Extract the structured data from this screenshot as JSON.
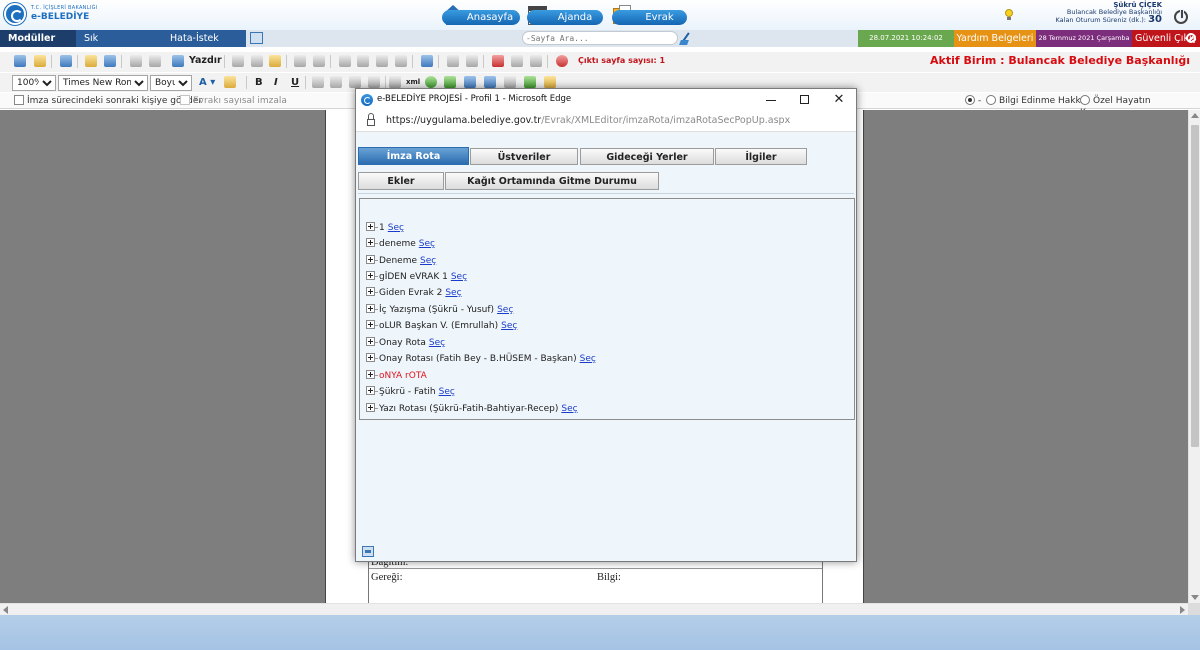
{
  "header": {
    "logo_top": "T.C. İÇİŞLERİ BAKANLIĞI",
    "logo_text": "e-BELEDİYE",
    "nav": [
      {
        "label": "Anasayfa",
        "icon": "home-icon"
      },
      {
        "label": "Ajanda",
        "icon": "calendar-icon",
        "icon_text": "13"
      },
      {
        "label": "Evrak",
        "icon": "documents-icon"
      }
    ],
    "user": {
      "name": "Şükrü ÇİÇEK",
      "unit": "Bulancak Belediye Başkanlığı",
      "timeout_label": "Kalan Oturum Süreniz (dk.):",
      "timeout_value": "30"
    }
  },
  "menubar": {
    "moduller": "Modüller",
    "sik": "Sık Kullanılanlar",
    "hata": "Hata-İstek Bildir",
    "search_placeholder": "-Sayfa Ara...",
    "datetime": "28.07.2021 10:24:02",
    "yardim": "Yardım Belgeleri",
    "today": "28 Temmuz 2021 Çarşamba",
    "exit": "Güvenli Çıkış"
  },
  "toolbar": {
    "print_label": "Yazdır",
    "xml_label": "xml",
    "page_count_label": "Çıktı sayfa sayısı: 1",
    "active_unit": "Aktif Birim : Bulancak Belediye Başkanlığı",
    "zoom": "100%",
    "font": "Times New Roman",
    "size": "Boyut",
    "format_buttons": [
      "A",
      "B",
      "I",
      "U"
    ]
  },
  "checkbar": {
    "sign_next": "İmza sürecindeki sonraki kişiye gönder",
    "sign_digital": "Evrakı sayısal imzala",
    "radio_none": "-",
    "radio_info": "Bilgi Edinme Hakkı",
    "radio_privacy": "Özel Hayatın Korunması"
  },
  "document": {
    "dagitim": "Dağıtım:",
    "geregi": "Gereği:",
    "bilgi": "Bilgi:"
  },
  "popup": {
    "title": "e-BELEDİYE PROJESİ - Profil 1 - Microsoft Edge",
    "url_host": "https://uygulama.belediye.gov.tr",
    "url_path": "/Evrak/XMLEditor/imzaRota/imzaRotaSecPopUp.aspx",
    "tabs": [
      {
        "label": "İmza Rota",
        "active": true
      },
      {
        "label": "Üstveriler",
        "active": false
      },
      {
        "label": "Gideceği Yerler",
        "active": false
      },
      {
        "label": "İlgiler",
        "active": false
      },
      {
        "label": "Ekler",
        "active": false
      },
      {
        "label": "Kağıt Ortamında Gitme Durumu",
        "active": false
      }
    ],
    "select_link": "Seç",
    "routes": [
      {
        "label": "1",
        "has_select": true
      },
      {
        "label": "deneme",
        "has_select": true
      },
      {
        "label": "Deneme",
        "has_select": true
      },
      {
        "label": "gİDEN eVRAK 1",
        "has_select": true
      },
      {
        "label": "Giden Evrak 2",
        "has_select": true
      },
      {
        "label": "İç Yazışma (Şükrü - Yusuf)",
        "has_select": true
      },
      {
        "label": "oLUR Başkan V. (Emrullah)",
        "has_select": true
      },
      {
        "label": "Onay Rota",
        "has_select": true
      },
      {
        "label": "Onay Rotası (Fatih Bey - B.HÜSEM - Başkan)",
        "has_select": true
      },
      {
        "label": "oNYA rOTA",
        "has_select": false,
        "color": "#e0141b"
      },
      {
        "label": "Şükrü - Fatih",
        "has_select": true
      },
      {
        "label": "Yazı Rotası (Şükrü-Fatih-Bahtiyar-Recep)",
        "has_select": true
      }
    ]
  },
  "colors": {
    "header_blue": "#1e6fbf",
    "moduller_bg": "#1d3e6b",
    "menu_blue": "#2a5d99",
    "date_green": "#6aa84f",
    "yardim_orange": "#e69215",
    "today_purple": "#7c2d7c",
    "exit_red": "#c0141b",
    "active_unit_red": "#d80b10",
    "active_tab_blue": "#2b6db1",
    "link_blue": "#1a3cc8"
  }
}
